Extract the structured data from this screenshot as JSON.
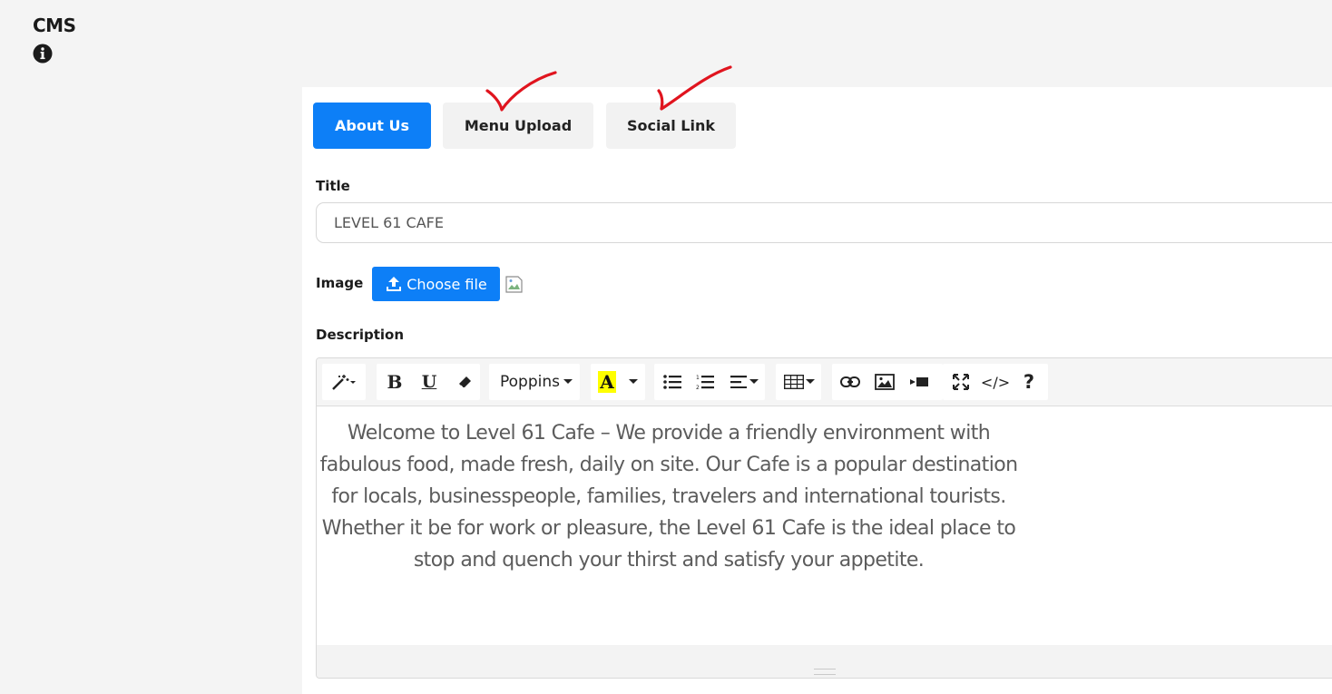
{
  "header": {
    "title": "CMS",
    "info_icon": "info-circle-icon"
  },
  "tabs": [
    {
      "label": "About Us",
      "active": true
    },
    {
      "label": "Menu Upload",
      "active": false
    },
    {
      "label": "Social Link",
      "active": false
    }
  ],
  "form": {
    "title_label": "Title",
    "title_value": "LEVEL 61 CAFE",
    "image_label": "Image",
    "choose_file_label": "Choose file",
    "description_label": "Description"
  },
  "editor": {
    "font_name": "Poppins",
    "content": "Welcome to Level 61 Cafe – We provide a friendly environment with fabulous food, made fresh, daily on site.  Our Cafe is a popular destination for locals, businesspeople, families, travelers and international tourists.  Whether it be for work or pleasure, the Level 61 Cafe is the ideal place to stop and quench your thirst and satisfy your appetite.",
    "toolbar": [
      "magic-wand-icon",
      "bold-icon",
      "underline-icon",
      "eraser-icon",
      "font-family-dropdown",
      "text-color-icon",
      "unordered-list-icon",
      "ordered-list-icon",
      "align-icon",
      "table-icon",
      "link-icon",
      "picture-icon",
      "video-icon",
      "fullscreen-icon",
      "code-view-icon",
      "help-icon"
    ],
    "code_label": "</>",
    "help_label": "?"
  },
  "colors": {
    "primary": "#0d7ff7",
    "annotation": "#e0141e",
    "highlight": "#ffff00"
  }
}
